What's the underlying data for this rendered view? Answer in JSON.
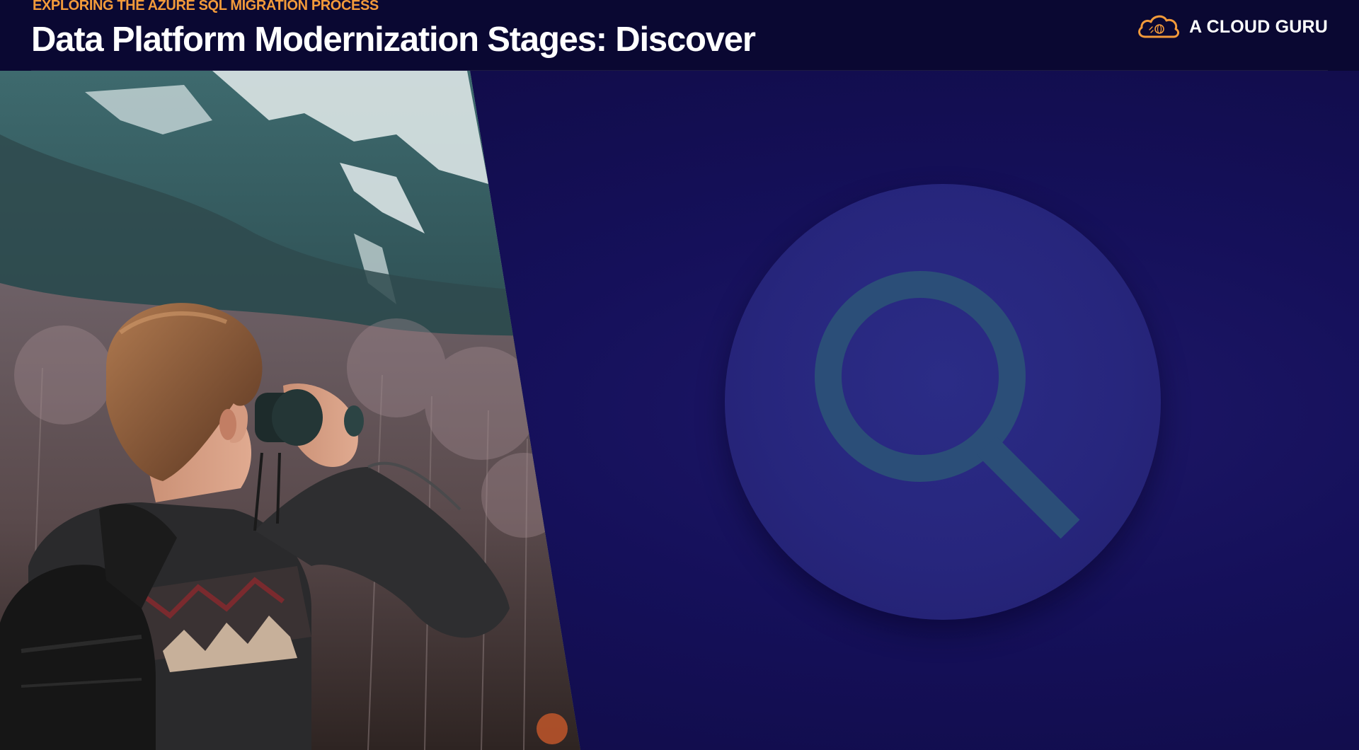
{
  "header": {
    "subtitle": "EXPLORING THE AZURE SQL MIGRATION PROCESS",
    "title": "Data Platform Modernization Stages: Discover",
    "brand": "A CLOUD GURU"
  },
  "icons": {
    "brand_logo": "cloud-logo-icon",
    "stage_icon": "search-icon"
  },
  "colors": {
    "background": "#110c4a",
    "header_background": "#0a0832",
    "subtitle": "#f29a3a",
    "title": "#ffffff",
    "badge": "#27267d",
    "magnifier": "#2b4e78"
  }
}
